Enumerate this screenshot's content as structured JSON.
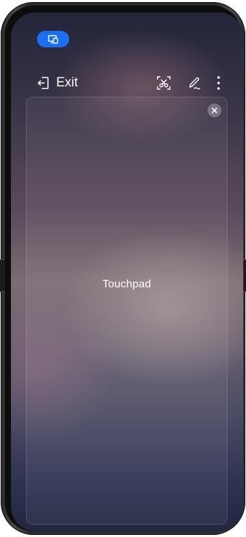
{
  "status_bar": {
    "cast_pill_color": "#1c6ff2",
    "cast_icon": "screen-cast-icon"
  },
  "toolbar": {
    "exit_label": "Exit",
    "exit_icon": "exit-icon",
    "screenshot_icon": "screenshot-scissors-icon",
    "annotate_icon": "pen-icon",
    "more_icon": "more-vertical-icon"
  },
  "touchpad": {
    "label": "Touchpad",
    "close_icon": "close-icon"
  }
}
